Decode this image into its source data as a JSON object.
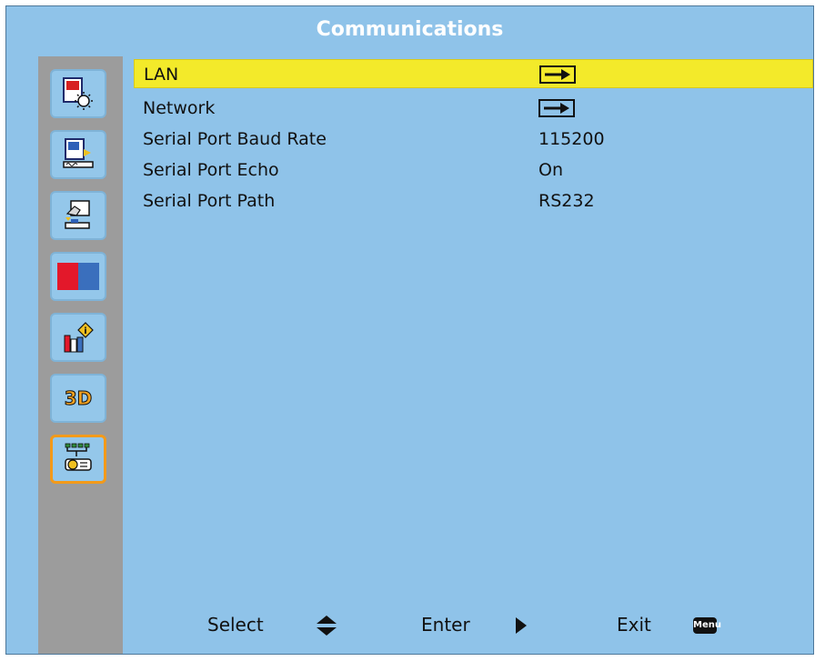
{
  "title": "Communications",
  "sidebar": {
    "items": [
      {
        "name": "picture-settings-icon"
      },
      {
        "name": "display-settings-icon"
      },
      {
        "name": "setup-icon"
      },
      {
        "name": "color-icon"
      },
      {
        "name": "info-icon"
      },
      {
        "name": "3d-icon",
        "label": "3D"
      },
      {
        "name": "communications-icon",
        "active": true
      }
    ]
  },
  "menu": {
    "items": [
      {
        "label": "LAN",
        "value": "",
        "type": "submenu",
        "selected": true
      },
      {
        "label": "Network",
        "value": "",
        "type": "submenu"
      },
      {
        "label": "Serial Port Baud Rate",
        "value": "115200",
        "type": "value"
      },
      {
        "label": "Serial Port Echo",
        "value": "On",
        "type": "value"
      },
      {
        "label": "Serial Port Path",
        "value": "RS232",
        "type": "value"
      }
    ]
  },
  "footer": {
    "select_label": "Select",
    "enter_label": "Enter",
    "exit_label": "Exit",
    "menu_key": "Menu"
  },
  "colors": {
    "background": "#8fc3e9",
    "sidebar": "#9c9c9c",
    "selection": "#f3ea2a",
    "active_border": "#f39a1a"
  }
}
